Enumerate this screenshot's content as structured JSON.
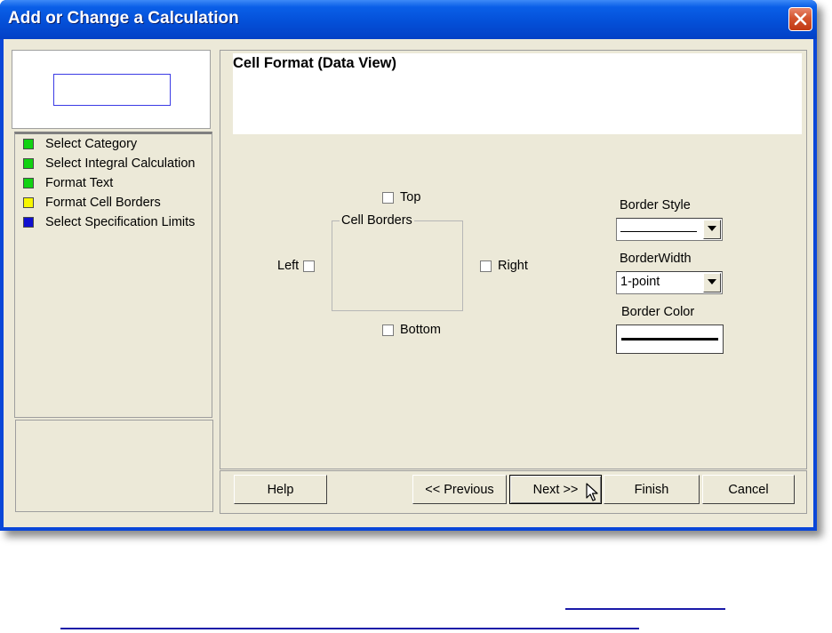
{
  "window": {
    "title": "Add or Change a Calculation"
  },
  "steps": [
    {
      "label": "Select Category",
      "color": "#12d212"
    },
    {
      "label": "Select Integral Calculation",
      "color": "#12d212"
    },
    {
      "label": "Format Text",
      "color": "#12d212"
    },
    {
      "label": "Format Cell Borders",
      "color": "#f7f700"
    },
    {
      "label": "Select Specification Limits",
      "color": "#1010d0"
    }
  ],
  "panel": {
    "title": "Cell Format (Data View)"
  },
  "borders": {
    "group_label": "Cell Borders",
    "top": "Top",
    "left": "Left",
    "right": "Right",
    "bottom": "Bottom"
  },
  "style": {
    "border_style_label": "Border Style",
    "border_width_label": "BorderWidth",
    "border_width_value": "1-point",
    "border_color_label": "Border Color"
  },
  "buttons": {
    "help": "Help",
    "previous": "<< Previous",
    "next": "Next >>",
    "finish": "Finish",
    "cancel": "Cancel"
  }
}
